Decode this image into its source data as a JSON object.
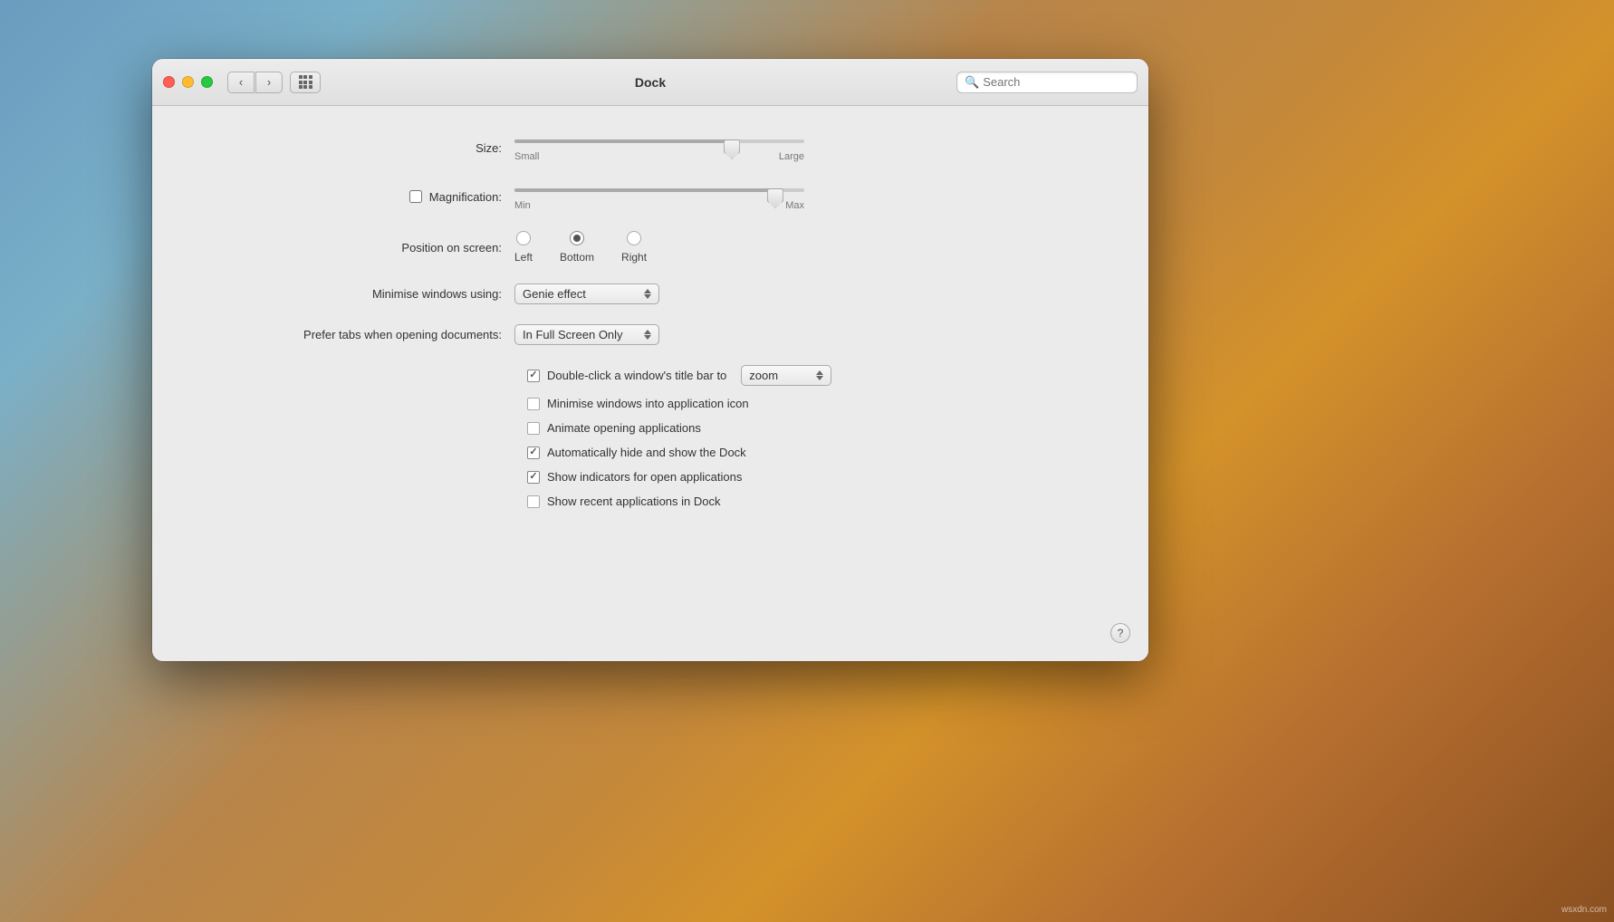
{
  "desktop": {
    "watermark": "wsxdn.com"
  },
  "window": {
    "title": "Dock"
  },
  "titlebar": {
    "back_label": "‹",
    "forward_label": "›",
    "search_placeholder": "Search"
  },
  "prefs": {
    "size_label": "Size:",
    "size_small": "Small",
    "size_large": "Large",
    "size_value": 75,
    "magnification_label": "Magnification:",
    "magnification_checked": false,
    "mag_min": "Min",
    "mag_max": "Max",
    "mag_value": 90,
    "position_label": "Position on screen:",
    "position_left": "Left",
    "position_bottom": "Bottom",
    "position_right": "Right",
    "position_selected": "Bottom",
    "minimise_label": "Minimise windows using:",
    "minimise_value": "Genie effect",
    "tabs_label": "Prefer tabs when opening documents:",
    "tabs_value": "In Full Screen Only",
    "double_click_label": "Double-click a window's title bar to",
    "double_click_checked": true,
    "double_click_value": "zoom",
    "minimise_icon_label": "Minimise windows into application icon",
    "minimise_icon_checked": false,
    "animate_label": "Animate opening applications",
    "animate_checked": false,
    "auto_hide_label": "Automatically hide and show the Dock",
    "auto_hide_checked": true,
    "show_indicators_label": "Show indicators for open applications",
    "show_indicators_checked": true,
    "show_recent_label": "Show recent applications in Dock",
    "show_recent_checked": false,
    "help_label": "?"
  }
}
